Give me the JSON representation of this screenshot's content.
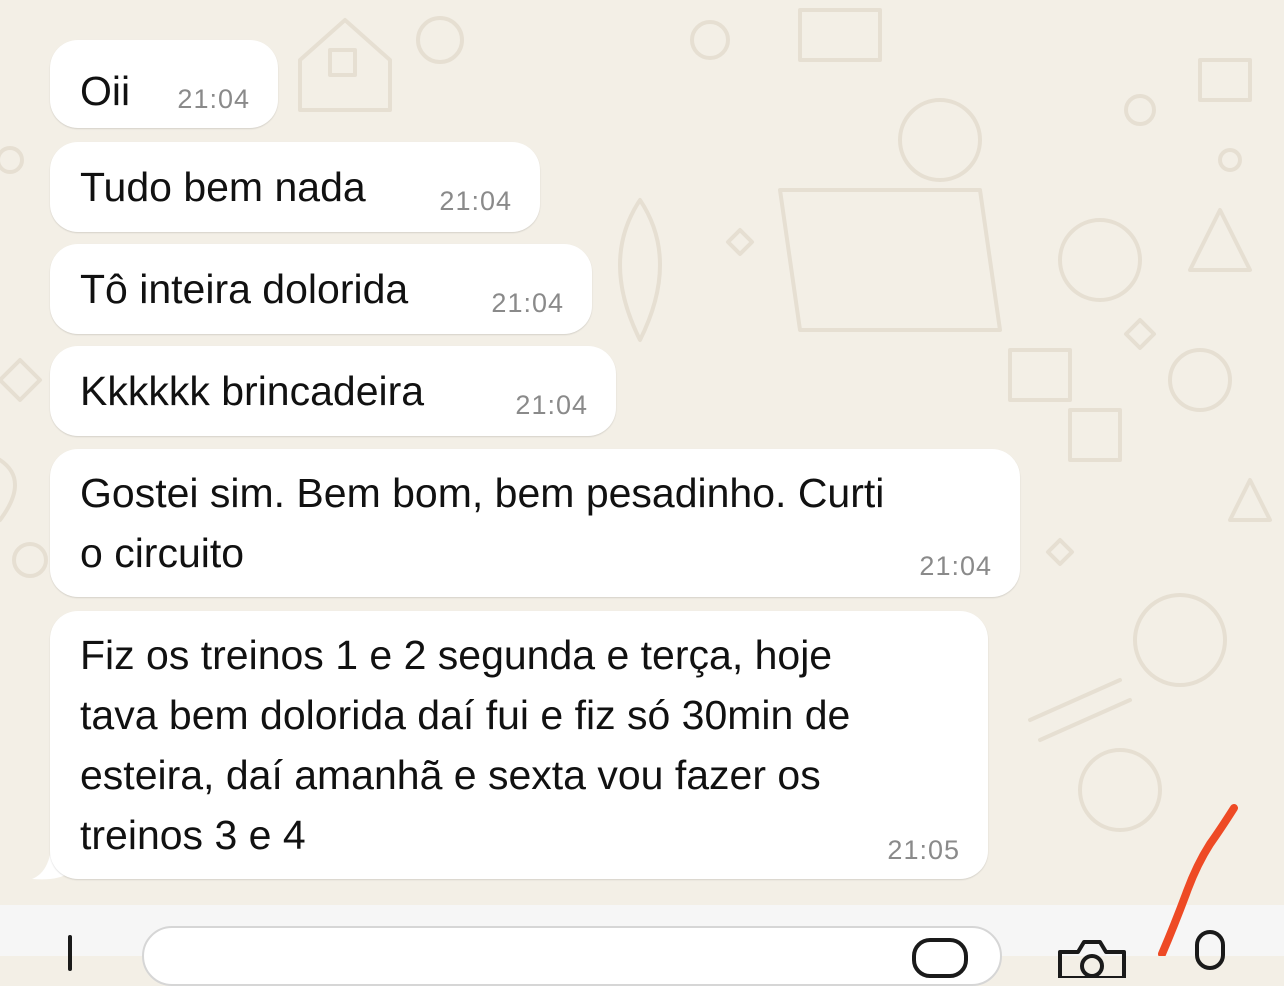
{
  "messages": [
    {
      "text": "Oii",
      "time": "21:04"
    },
    {
      "text": "Tudo bem nada",
      "time": "21:04"
    },
    {
      "text": "Tô inteira dolorida",
      "time": "21:04"
    },
    {
      "text": "Kkkkkk brincadeira",
      "time": "21:04"
    },
    {
      "text": "Gostei sim. Bem bom, bem pesadinho. Curti\no circuito",
      "time": "21:04"
    },
    {
      "text": "Fiz os treinos 1 e 2 segunda e terça, hoje\ntava bem dolorida daí fui e fiz só 30min de\nesteira, daí amanhã e sexta vou fazer os\ntreinos 3 e 4",
      "time": "21:05"
    }
  ],
  "composer": {
    "input_value": "",
    "icons": [
      "plus-icon",
      "sticker-icon",
      "camera-icon",
      "microphone-icon"
    ]
  },
  "colors": {
    "wallpaper": "#f3efe6",
    "doodle": "#e6dfd2",
    "bubble": "#ffffff",
    "time_text": "#8a8a8a",
    "annotation_stroke": "#ee4a25"
  }
}
